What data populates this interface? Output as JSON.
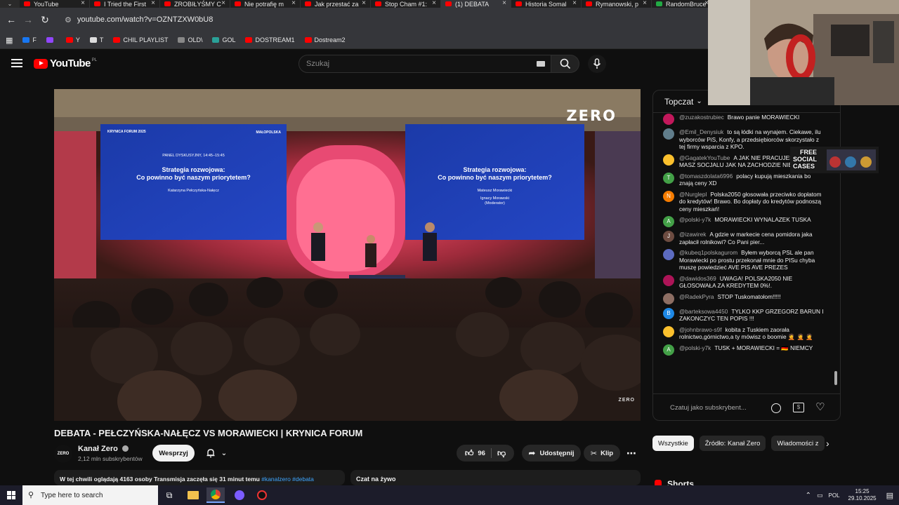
{
  "browser": {
    "tabs": [
      {
        "title": "YouTube",
        "color": "#ff0000"
      },
      {
        "title": "I Tried the First",
        "color": "#ff0000"
      },
      {
        "title": "ZROBIŁYŚMY C",
        "color": "#ff0000"
      },
      {
        "title": "Nie potrafię m",
        "color": "#ff0000"
      },
      {
        "title": "Jak przestać za",
        "color": "#ff0000"
      },
      {
        "title": "Stop Cham #1:",
        "color": "#ff0000"
      },
      {
        "title": "(1) DEBATA",
        "color": "#ff0000"
      },
      {
        "title": "Historia Somal",
        "color": "#ff0000"
      },
      {
        "title": "Rymanowski, p",
        "color": "#ff0000"
      },
      {
        "title": "RandomBruce",
        "color": "#22aa44"
      }
    ],
    "url": "youtube.com/watch?v=OZNTZXW0bU8",
    "bookmarks": [
      {
        "label": "F",
        "color": "#1877f2"
      },
      {
        "label": "",
        "color": "#9146ff"
      },
      {
        "label": "Y",
        "color": "#ff0000"
      },
      {
        "label": "T",
        "color": "#dddddd"
      },
      {
        "label": "CHIL PLAYLIST",
        "color": "#ff0000"
      },
      {
        "label": "OLD\\",
        "color": "#888888"
      },
      {
        "label": "GOL",
        "color": "#2aa198"
      },
      {
        "label": "DOSTREAM1",
        "color": "#ff0000"
      },
      {
        "label": "Dostream2",
        "color": "#ff0000"
      }
    ]
  },
  "yt": {
    "logo_text": "YouTube",
    "logo_country": "PL",
    "search_placeholder": "Szukaj",
    "accent": "#ff0000"
  },
  "video": {
    "watermark": "ZERO",
    "watermark_small": "ZERO",
    "screen_panel": "PANEL DYSKUSYJNY, 14:45–15:45",
    "screen_title_line1": "Strategia rozwojowa:",
    "screen_title_line2": "Co powinno być naszym priorytetem?",
    "screen_speaker1": "Katarzyna Pełczyńska-Nałęcz",
    "screen_speaker2": "Mateusz Morawiecki",
    "screen_moderator": "Ignacy Morawski",
    "screen_moderator_role": "(Moderator)",
    "screen_logo_left": "KRYNICA FORUM 2025",
    "screen_logo_right": "MAŁOPOLSKA",
    "title": "DEBATA - PEŁCZYŃSKA-NAŁĘCZ VS MORAWIECKI | KRYNICA FORUM"
  },
  "channel": {
    "avatar_text": "ZERO",
    "name": "Kanał Zero",
    "subscribers": "2,12 mln subskrybentów",
    "support_label": "Wesprzyj",
    "likes": "96",
    "share_label": "Udostępnij",
    "clip_label": "Klip",
    "more_label": "⋯"
  },
  "description": {
    "text": "W tej chwili oglądają 4163 osoby  Transmisja zaczęła się 31 minut temu ",
    "tags": "#kanalzero #debata"
  },
  "live_chat_label": "Czat na żywo",
  "chat": {
    "sort_label": "Topczat",
    "input_placeholder": "Czatuj jako subskrybent...",
    "messages": [
      {
        "user": "@zuzakostrubiec",
        "text": "Brawo panie MORAWIECKI",
        "av": "",
        "color": "#c2185b"
      },
      {
        "user": "@Emil_Denysiuk",
        "text": "to są łódki na wynajem. Ciekawe, ilu wyborców PiS, Konfy, a przedsiębiorców skorzystało z tej firmy wsparcia z KPO.",
        "av": "",
        "color": "#607d8b"
      },
      {
        "user": "@GagatekYouTube",
        "text": "A JAK NIE PRACUJESZ TO NIE MASZ SOCJALU JAK NA ZACHODZIE NIE DAJĄ NIC",
        "av": "",
        "color": "#fbc02d"
      },
      {
        "user": "@tomaszdolata6996",
        "text": "polacy kupują mieszkania bo znają ceny XD",
        "av": "T",
        "color": "#43a047"
      },
      {
        "user": "@Nurglepl",
        "text": "Polska2050 głosowała przeciwko dopłatom do kredytów! Brawo. Bo dopłaty do kredytów podnoszą ceny mieszkań!",
        "av": "N",
        "color": "#f57c00"
      },
      {
        "user": "@polski-y7k",
        "text": "MORAWIECKI WYNALAZEK TUSKA",
        "av": "A",
        "color": "#43a047"
      },
      {
        "user": "@izawirek",
        "text": "A gdzie w markecie cena pomidora jaka zapłacił rolnikowi? Co Pani pier...",
        "av": "J",
        "color": "#6d4c41"
      },
      {
        "user": "@kubeq1polskagurom",
        "text": "Byłem wyborcą PSL ale pan Morawiecki po prostu przekonał mnie do PISu chyba muszę powiedzieć AVE PIS AVE PREZES",
        "av": "",
        "color": "#5c6bc0"
      },
      {
        "user": "@dawidos369",
        "text": "UWAGA! POLSKA2050 NIE GŁOSOWAŁA ZA KREDYTEM 0%!.",
        "av": "",
        "color": "#ad1457"
      },
      {
        "user": "@RadekPyra",
        "text": "STOP Tuskomatołom!!!!!",
        "av": "",
        "color": "#8d6e63"
      },
      {
        "user": "@barteksowa4450",
        "text": "TYLKO KKP GRZEGORZ BARUN I ZAKONCZYC TEN POPIS !!!",
        "av": "B",
        "color": "#1e88e5"
      },
      {
        "user": "@johnbrawo-s9f",
        "text": "kobita z Tuskiem zaorała rolnictwo,górnictwo,a ty mówisz o boomie 🤦 🤦 🤦",
        "av": "",
        "color": "#fbc02d"
      },
      {
        "user": "@polski-y7k",
        "text": "TUSK + MORAWIECKI = 🇩🇪 NIEMCY",
        "av": "A",
        "color": "#43a047"
      }
    ]
  },
  "chips": [
    {
      "label": "Wszystkie",
      "active": true
    },
    {
      "label": "Źródło: Kanał Zero",
      "active": false
    },
    {
      "label": "Wiadomości z",
      "active": false
    }
  ],
  "shorts_label": "Shorts",
  "ad": {
    "line1": "FREE",
    "line2": "SOCIAL",
    "line3": "CASES"
  },
  "taskbar": {
    "search_placeholder": "Type here to search",
    "lang": "POL",
    "time": "15:25",
    "date": "29.10.2025"
  }
}
